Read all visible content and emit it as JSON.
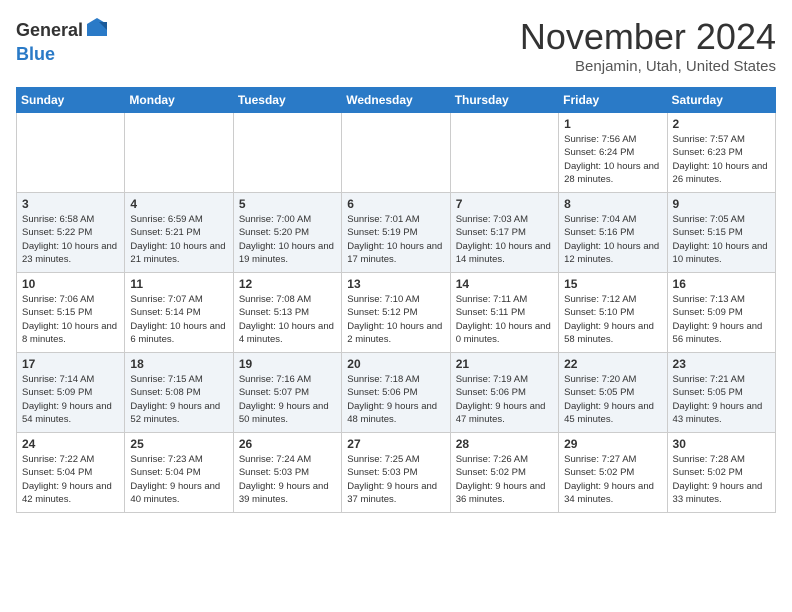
{
  "header": {
    "logo_general": "General",
    "logo_blue": "Blue",
    "month": "November 2024",
    "location": "Benjamin, Utah, United States"
  },
  "weekdays": [
    "Sunday",
    "Monday",
    "Tuesday",
    "Wednesday",
    "Thursday",
    "Friday",
    "Saturday"
  ],
  "weeks": [
    [
      {
        "day": "",
        "info": ""
      },
      {
        "day": "",
        "info": ""
      },
      {
        "day": "",
        "info": ""
      },
      {
        "day": "",
        "info": ""
      },
      {
        "day": "",
        "info": ""
      },
      {
        "day": "1",
        "info": "Sunrise: 7:56 AM\nSunset: 6:24 PM\nDaylight: 10 hours and 28 minutes."
      },
      {
        "day": "2",
        "info": "Sunrise: 7:57 AM\nSunset: 6:23 PM\nDaylight: 10 hours and 26 minutes."
      }
    ],
    [
      {
        "day": "3",
        "info": "Sunrise: 6:58 AM\nSunset: 5:22 PM\nDaylight: 10 hours and 23 minutes."
      },
      {
        "day": "4",
        "info": "Sunrise: 6:59 AM\nSunset: 5:21 PM\nDaylight: 10 hours and 21 minutes."
      },
      {
        "day": "5",
        "info": "Sunrise: 7:00 AM\nSunset: 5:20 PM\nDaylight: 10 hours and 19 minutes."
      },
      {
        "day": "6",
        "info": "Sunrise: 7:01 AM\nSunset: 5:19 PM\nDaylight: 10 hours and 17 minutes."
      },
      {
        "day": "7",
        "info": "Sunrise: 7:03 AM\nSunset: 5:17 PM\nDaylight: 10 hours and 14 minutes."
      },
      {
        "day": "8",
        "info": "Sunrise: 7:04 AM\nSunset: 5:16 PM\nDaylight: 10 hours and 12 minutes."
      },
      {
        "day": "9",
        "info": "Sunrise: 7:05 AM\nSunset: 5:15 PM\nDaylight: 10 hours and 10 minutes."
      }
    ],
    [
      {
        "day": "10",
        "info": "Sunrise: 7:06 AM\nSunset: 5:15 PM\nDaylight: 10 hours and 8 minutes."
      },
      {
        "day": "11",
        "info": "Sunrise: 7:07 AM\nSunset: 5:14 PM\nDaylight: 10 hours and 6 minutes."
      },
      {
        "day": "12",
        "info": "Sunrise: 7:08 AM\nSunset: 5:13 PM\nDaylight: 10 hours and 4 minutes."
      },
      {
        "day": "13",
        "info": "Sunrise: 7:10 AM\nSunset: 5:12 PM\nDaylight: 10 hours and 2 minutes."
      },
      {
        "day": "14",
        "info": "Sunrise: 7:11 AM\nSunset: 5:11 PM\nDaylight: 10 hours and 0 minutes."
      },
      {
        "day": "15",
        "info": "Sunrise: 7:12 AM\nSunset: 5:10 PM\nDaylight: 9 hours and 58 minutes."
      },
      {
        "day": "16",
        "info": "Sunrise: 7:13 AM\nSunset: 5:09 PM\nDaylight: 9 hours and 56 minutes."
      }
    ],
    [
      {
        "day": "17",
        "info": "Sunrise: 7:14 AM\nSunset: 5:09 PM\nDaylight: 9 hours and 54 minutes."
      },
      {
        "day": "18",
        "info": "Sunrise: 7:15 AM\nSunset: 5:08 PM\nDaylight: 9 hours and 52 minutes."
      },
      {
        "day": "19",
        "info": "Sunrise: 7:16 AM\nSunset: 5:07 PM\nDaylight: 9 hours and 50 minutes."
      },
      {
        "day": "20",
        "info": "Sunrise: 7:18 AM\nSunset: 5:06 PM\nDaylight: 9 hours and 48 minutes."
      },
      {
        "day": "21",
        "info": "Sunrise: 7:19 AM\nSunset: 5:06 PM\nDaylight: 9 hours and 47 minutes."
      },
      {
        "day": "22",
        "info": "Sunrise: 7:20 AM\nSunset: 5:05 PM\nDaylight: 9 hours and 45 minutes."
      },
      {
        "day": "23",
        "info": "Sunrise: 7:21 AM\nSunset: 5:05 PM\nDaylight: 9 hours and 43 minutes."
      }
    ],
    [
      {
        "day": "24",
        "info": "Sunrise: 7:22 AM\nSunset: 5:04 PM\nDaylight: 9 hours and 42 minutes."
      },
      {
        "day": "25",
        "info": "Sunrise: 7:23 AM\nSunset: 5:04 PM\nDaylight: 9 hours and 40 minutes."
      },
      {
        "day": "26",
        "info": "Sunrise: 7:24 AM\nSunset: 5:03 PM\nDaylight: 9 hours and 39 minutes."
      },
      {
        "day": "27",
        "info": "Sunrise: 7:25 AM\nSunset: 5:03 PM\nDaylight: 9 hours and 37 minutes."
      },
      {
        "day": "28",
        "info": "Sunrise: 7:26 AM\nSunset: 5:02 PM\nDaylight: 9 hours and 36 minutes."
      },
      {
        "day": "29",
        "info": "Sunrise: 7:27 AM\nSunset: 5:02 PM\nDaylight: 9 hours and 34 minutes."
      },
      {
        "day": "30",
        "info": "Sunrise: 7:28 AM\nSunset: 5:02 PM\nDaylight: 9 hours and 33 minutes."
      }
    ]
  ]
}
